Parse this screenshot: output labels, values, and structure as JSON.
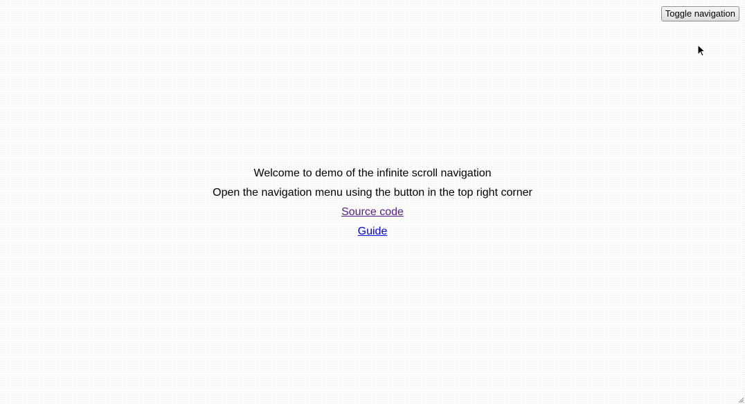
{
  "header": {
    "toggle_label": "Toggle navigation"
  },
  "main": {
    "welcome_text": "Welcome to demo of the infinite scroll navigation",
    "instruction_text": "Open the navigation menu using the button in the top right corner",
    "source_link": "Source code",
    "guide_link": "Guide"
  },
  "colors": {
    "visited_link": "#551a8b",
    "unvisited_link": "#0000ee"
  },
  "icons": {
    "cursor": "mouse-pointer-icon",
    "resize": "resize-grip-icon"
  }
}
